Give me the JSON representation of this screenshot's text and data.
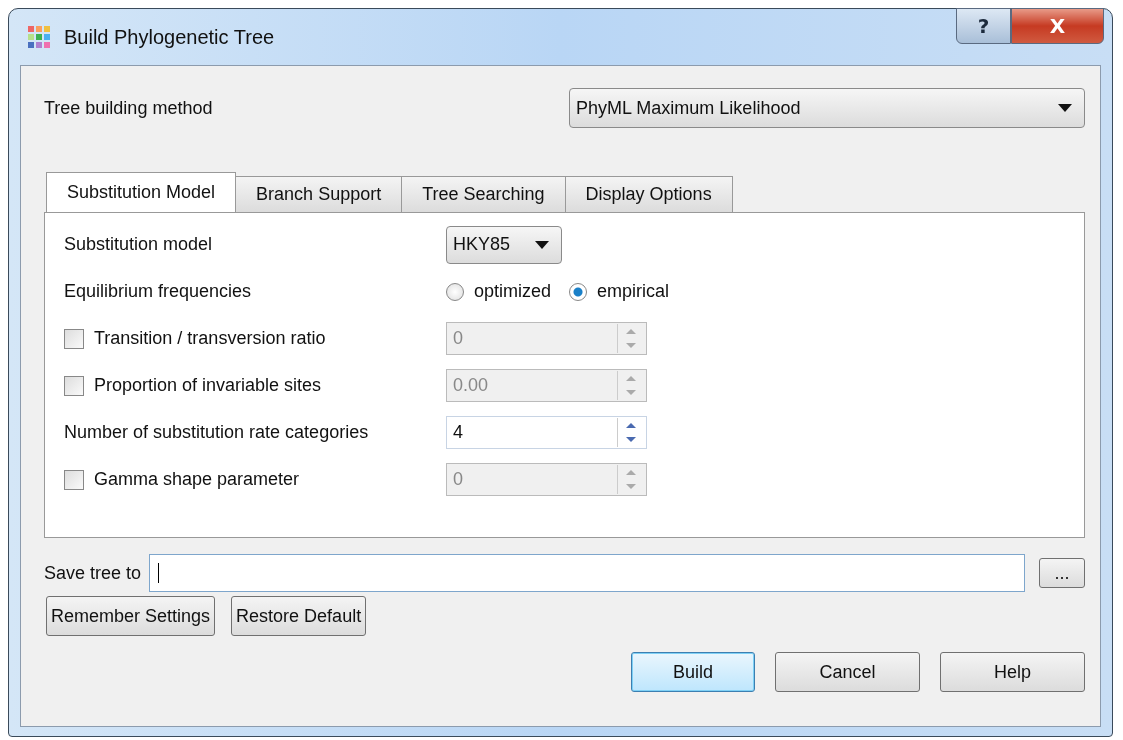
{
  "window": {
    "title": "Build Phylogenetic Tree",
    "help_glyph": "?",
    "close_glyph": "X"
  },
  "method": {
    "label": "Tree building method",
    "value": "PhyML Maximum Likelihood"
  },
  "tabs": [
    {
      "label": "Substitution Model",
      "selected": true
    },
    {
      "label": "Branch Support",
      "selected": false
    },
    {
      "label": "Tree Searching",
      "selected": false
    },
    {
      "label": "Display Options",
      "selected": false
    }
  ],
  "rows": [
    {
      "kind": "dropdown",
      "label": "Substitution model",
      "value": "HKY85"
    },
    {
      "kind": "radio",
      "label": "Equilibrium frequencies",
      "options": [
        {
          "label": "optimized",
          "selected": false
        },
        {
          "label": "empirical",
          "selected": true
        }
      ]
    },
    {
      "kind": "check-spin",
      "label": "Transition / transversion ratio",
      "checked": false,
      "value": "0"
    },
    {
      "kind": "check-spin",
      "label": "Proportion of invariable sites",
      "checked": false,
      "value": "0.00"
    },
    {
      "kind": "spin",
      "label": "Number of substitution rate categories",
      "value": "4"
    },
    {
      "kind": "check-spin",
      "label": "Gamma shape parameter",
      "checked": false,
      "value": "0"
    }
  ],
  "save": {
    "label": "Save tree to",
    "browse": "..."
  },
  "left_buttons": [
    "Remember Settings",
    "Restore Default"
  ],
  "buttons": [
    {
      "label": "Build",
      "default": true
    },
    {
      "label": "Cancel",
      "default": false
    },
    {
      "label": "Help",
      "default": false
    }
  ]
}
